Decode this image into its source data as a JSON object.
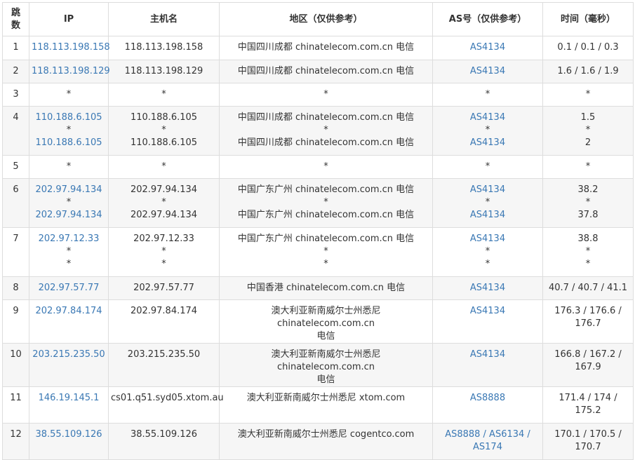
{
  "headers": {
    "hop": "跳数",
    "ip": "IP",
    "hostname": "主机名",
    "location": "地区（仅供参考）",
    "as": "AS号（仅供参考）",
    "time": "时间（毫秒）"
  },
  "rows": [
    {
      "hop": "1",
      "ip": [
        "118.113.198.158"
      ],
      "host": [
        "118.113.198.158"
      ],
      "loc": [
        "中国四川成都 chinatelecom.com.cn 电信"
      ],
      "as": [
        "AS4134"
      ],
      "time": [
        "0.1 / 0.1 / 0.3"
      ]
    },
    {
      "hop": "2",
      "ip": [
        "118.113.198.129"
      ],
      "host": [
        "118.113.198.129"
      ],
      "loc": [
        "中国四川成都 chinatelecom.com.cn 电信"
      ],
      "as": [
        "AS4134"
      ],
      "time": [
        "1.6 / 1.6 / 1.9"
      ]
    },
    {
      "hop": "3",
      "ip": [
        "*"
      ],
      "host": [
        "*"
      ],
      "loc": [
        "*"
      ],
      "as": [
        "*"
      ],
      "time": [
        "*"
      ]
    },
    {
      "hop": "4",
      "ip": [
        "110.188.6.105",
        "*",
        "110.188.6.105"
      ],
      "host": [
        "110.188.6.105",
        "*",
        "110.188.6.105"
      ],
      "loc": [
        "中国四川成都 chinatelecom.com.cn 电信",
        "*",
        "中国四川成都 chinatelecom.com.cn 电信"
      ],
      "as": [
        "AS4134",
        "*",
        "AS4134"
      ],
      "time": [
        "1.5",
        "*",
        "2"
      ]
    },
    {
      "hop": "5",
      "ip": [
        "*"
      ],
      "host": [
        "*"
      ],
      "loc": [
        "*"
      ],
      "as": [
        "*"
      ],
      "time": [
        "*"
      ]
    },
    {
      "hop": "6",
      "ip": [
        "202.97.94.134",
        "*",
        "202.97.94.134"
      ],
      "host": [
        "202.97.94.134",
        "*",
        "202.97.94.134"
      ],
      "loc": [
        "中国广东广州 chinatelecom.com.cn 电信",
        "*",
        "中国广东广州 chinatelecom.com.cn 电信"
      ],
      "as": [
        "AS4134",
        "*",
        "AS4134"
      ],
      "time": [
        "38.2",
        "*",
        "37.8"
      ]
    },
    {
      "hop": "7",
      "ip": [
        "202.97.12.33",
        "*",
        "*"
      ],
      "host": [
        "202.97.12.33",
        "*",
        "*"
      ],
      "loc": [
        "中国广东广州 chinatelecom.com.cn 电信",
        "*",
        "*"
      ],
      "as": [
        "AS4134",
        "*",
        "*"
      ],
      "time": [
        "38.8",
        "*",
        "*"
      ]
    },
    {
      "hop": "8",
      "ip": [
        "202.97.57.77"
      ],
      "host": [
        "202.97.57.77"
      ],
      "loc": [
        "中国香港 chinatelecom.com.cn 电信"
      ],
      "as": [
        "AS4134"
      ],
      "time": [
        "40.7 / 40.7 / 41.1"
      ]
    },
    {
      "hop": "9",
      "ip": [
        "202.97.84.174"
      ],
      "host": [
        "202.97.84.174"
      ],
      "loc": [
        "澳大利亚新南威尔士州悉尼 chinatelecom.com.cn",
        "电信"
      ],
      "as": [
        "AS4134"
      ],
      "time": [
        "176.3 / 176.6 /",
        "176.7"
      ]
    },
    {
      "hop": "10",
      "ip": [
        "203.215.235.50"
      ],
      "host": [
        "203.215.235.50"
      ],
      "loc": [
        "澳大利亚新南威尔士州悉尼 chinatelecom.com.cn",
        "电信"
      ],
      "as": [
        "AS4134"
      ],
      "time": [
        "166.8 / 167.2 /",
        "167.9"
      ]
    },
    {
      "hop": "11",
      "ip": [
        "146.19.145.1"
      ],
      "host": [
        "cs01.q51.syd05.xtom.au"
      ],
      "loc": [
        "澳大利亚新南威尔士州悉尼 xtom.com"
      ],
      "as": [
        "AS8888"
      ],
      "time": [
        "171.4 / 174 /",
        "175.2"
      ]
    },
    {
      "hop": "12",
      "ip": [
        "38.55.109.126"
      ],
      "host": [
        "38.55.109.126"
      ],
      "loc": [
        "澳大利亚新南威尔士州悉尼 cogentco.com"
      ],
      "as": [
        "AS8888 / AS6134 /",
        "AS174"
      ],
      "time": [
        "170.1 / 170.5 /",
        "170.7"
      ]
    }
  ],
  "colors": {
    "link": "#3a78b4",
    "border": "#dddddd",
    "alt_row": "#f6f6f6",
    "text": "#333333"
  }
}
